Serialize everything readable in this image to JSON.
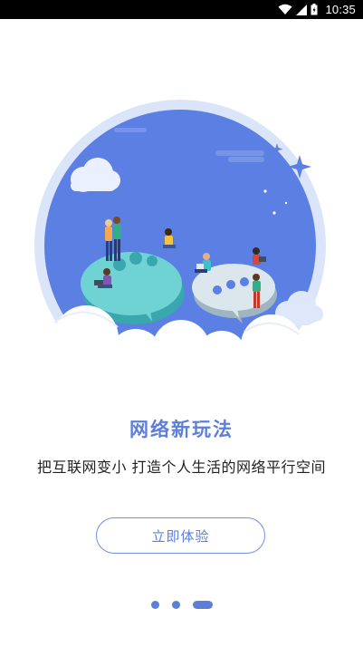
{
  "status_bar": {
    "time": "10:35",
    "icons": [
      "wifi-icon",
      "cell-signal-icon",
      "battery-icon"
    ]
  },
  "onboarding": {
    "title": "网络新玩法",
    "subtitle": "把互联网变小 打造个人生活的网络平行空间",
    "cta_label": "立即体验",
    "page_count": 3,
    "active_page": 3
  },
  "colors": {
    "accent": "#5e7fd8",
    "circle_fill": "#5b7fe3",
    "circle_ring": "#c9d7f6",
    "bubble_teal": "#6fd3d3",
    "bubble_gray": "#dbe7ec",
    "text_dark": "#222222"
  }
}
